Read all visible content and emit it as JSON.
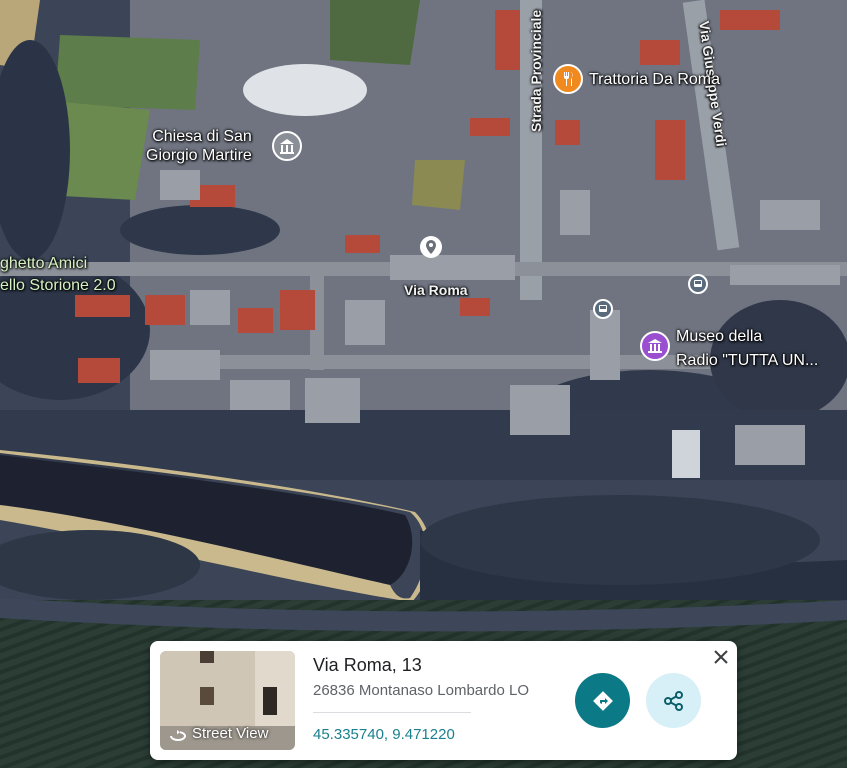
{
  "map": {
    "pois": {
      "trattoria": "Trattoria Da Roma",
      "chiesa": "Chiesa di San\nGiorgio Martire",
      "museo_line1": "Museo della",
      "museo_line2": "Radio \"TUTTA UN...",
      "ghetto_line1": "ghetto Amici",
      "ghetto_line2": "ello Storione 2.0"
    },
    "roads": {
      "strada_provinciale": "Strada Provinciale",
      "via_verdi": "Via Giuseppe Verdi",
      "via_roma": "Via Roma"
    },
    "icons": {
      "restaurant": "fork-knife-icon",
      "church": "church-icon",
      "museum": "museum-icon",
      "pin": "location-pin-icon",
      "bus": "bus-stop-icon"
    }
  },
  "card": {
    "title": "Via Roma, 13",
    "address": "26836 Montanaso Lombardo LO",
    "coords": "45.335740, 9.471220",
    "street_view_label": "Street View",
    "directions_icon": "directions-icon",
    "share_icon": "share-icon",
    "close_icon": "close-icon"
  },
  "colors": {
    "accent": "#0b7a86",
    "share_bg": "#d7f0f7",
    "restaurant_pin": "#f08a1f",
    "museum_pin": "#9a4fd1",
    "coords_text": "#1a7f8e"
  }
}
